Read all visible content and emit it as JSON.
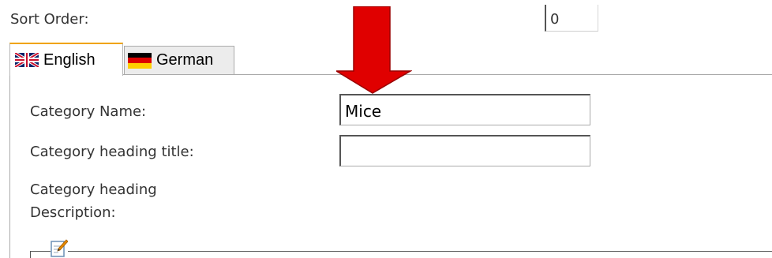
{
  "sort_order": {
    "label": "Sort Order:",
    "value": "0"
  },
  "tabs": [
    {
      "label": "English",
      "flag": "uk-flag-icon",
      "active": true
    },
    {
      "label": "German",
      "flag": "germany-flag-icon",
      "active": false
    }
  ],
  "form": {
    "category_name": {
      "label": "Category Name:",
      "value": "Mice"
    },
    "category_heading_title": {
      "label": "Category heading title:",
      "value": ""
    },
    "category_heading_description": {
      "label_line1": "Category heading",
      "label_line2": "Description:"
    }
  },
  "editor": {
    "toolbar_icon": "edit-document-icon"
  },
  "annotation": {
    "icon": "red-down-arrow",
    "color": "#e00000"
  },
  "colors": {
    "active_tab_top": "#f0a400",
    "border": "#aaaaaa",
    "text": "#333333"
  }
}
